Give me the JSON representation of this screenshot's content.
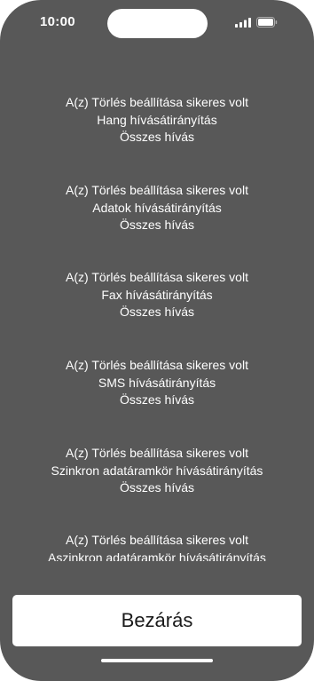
{
  "status_bar": {
    "time": "10:00",
    "signal_icon": "cellular-signal-icon",
    "battery_icon": "battery-icon"
  },
  "messages": [
    {
      "line1": "A(z) Törlés beállítása sikeres volt",
      "line2": "Hang hívásátirányítás",
      "line3": "Összes hívás"
    },
    {
      "line1": "A(z) Törlés beállítása sikeres volt",
      "line2": "Adatok hívásátirányítás",
      "line3": "Összes hívás"
    },
    {
      "line1": "A(z) Törlés beállítása sikeres volt",
      "line2": "Fax hívásátirányítás",
      "line3": "Összes hívás"
    },
    {
      "line1": "A(z) Törlés beállítása sikeres volt",
      "line2": "SMS hívásátirányítás",
      "line3": "Összes hívás"
    },
    {
      "line1": "A(z) Törlés beállítása sikeres volt",
      "line2": "Szinkron adatáramkör hívásátirányítás",
      "line3": "Összes hívás"
    },
    {
      "line1": "A(z) Törlés beállítása sikeres volt",
      "line2": "Aszinkron adatáramkör hívásátirányítás"
    }
  ],
  "close_button": {
    "label": "Bezárás"
  },
  "colors": {
    "background": "#585858",
    "text": "#ffffff",
    "button_background": "#ffffff",
    "button_text": "#1a1a1a"
  }
}
